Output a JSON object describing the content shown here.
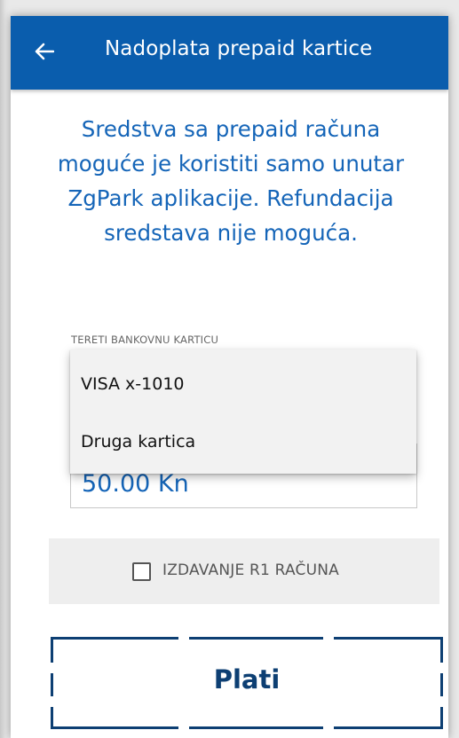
{
  "appbar": {
    "title": "Nadoplata prepaid kartice",
    "back_icon": "arrow-left-icon"
  },
  "notice": {
    "text": "Sredstva sa prepaid računa moguće je koristiti samo unutar ZgPark aplikacije. Refundacija sredstava nije moguća."
  },
  "card_field": {
    "label": "TERETI BANKOVNU KARTICU",
    "options": [
      "VISA x-1010",
      "Druga kartica"
    ]
  },
  "amount_field": {
    "value": "50.00 Kn"
  },
  "r1": {
    "label": "IZDAVANJE R1 RAČUNA",
    "checked": false
  },
  "pay_button": {
    "label": "Plati"
  },
  "colors": {
    "appbar": "#0a5dad",
    "text_accent": "#1565b8",
    "button_dark": "#0d3f73"
  }
}
